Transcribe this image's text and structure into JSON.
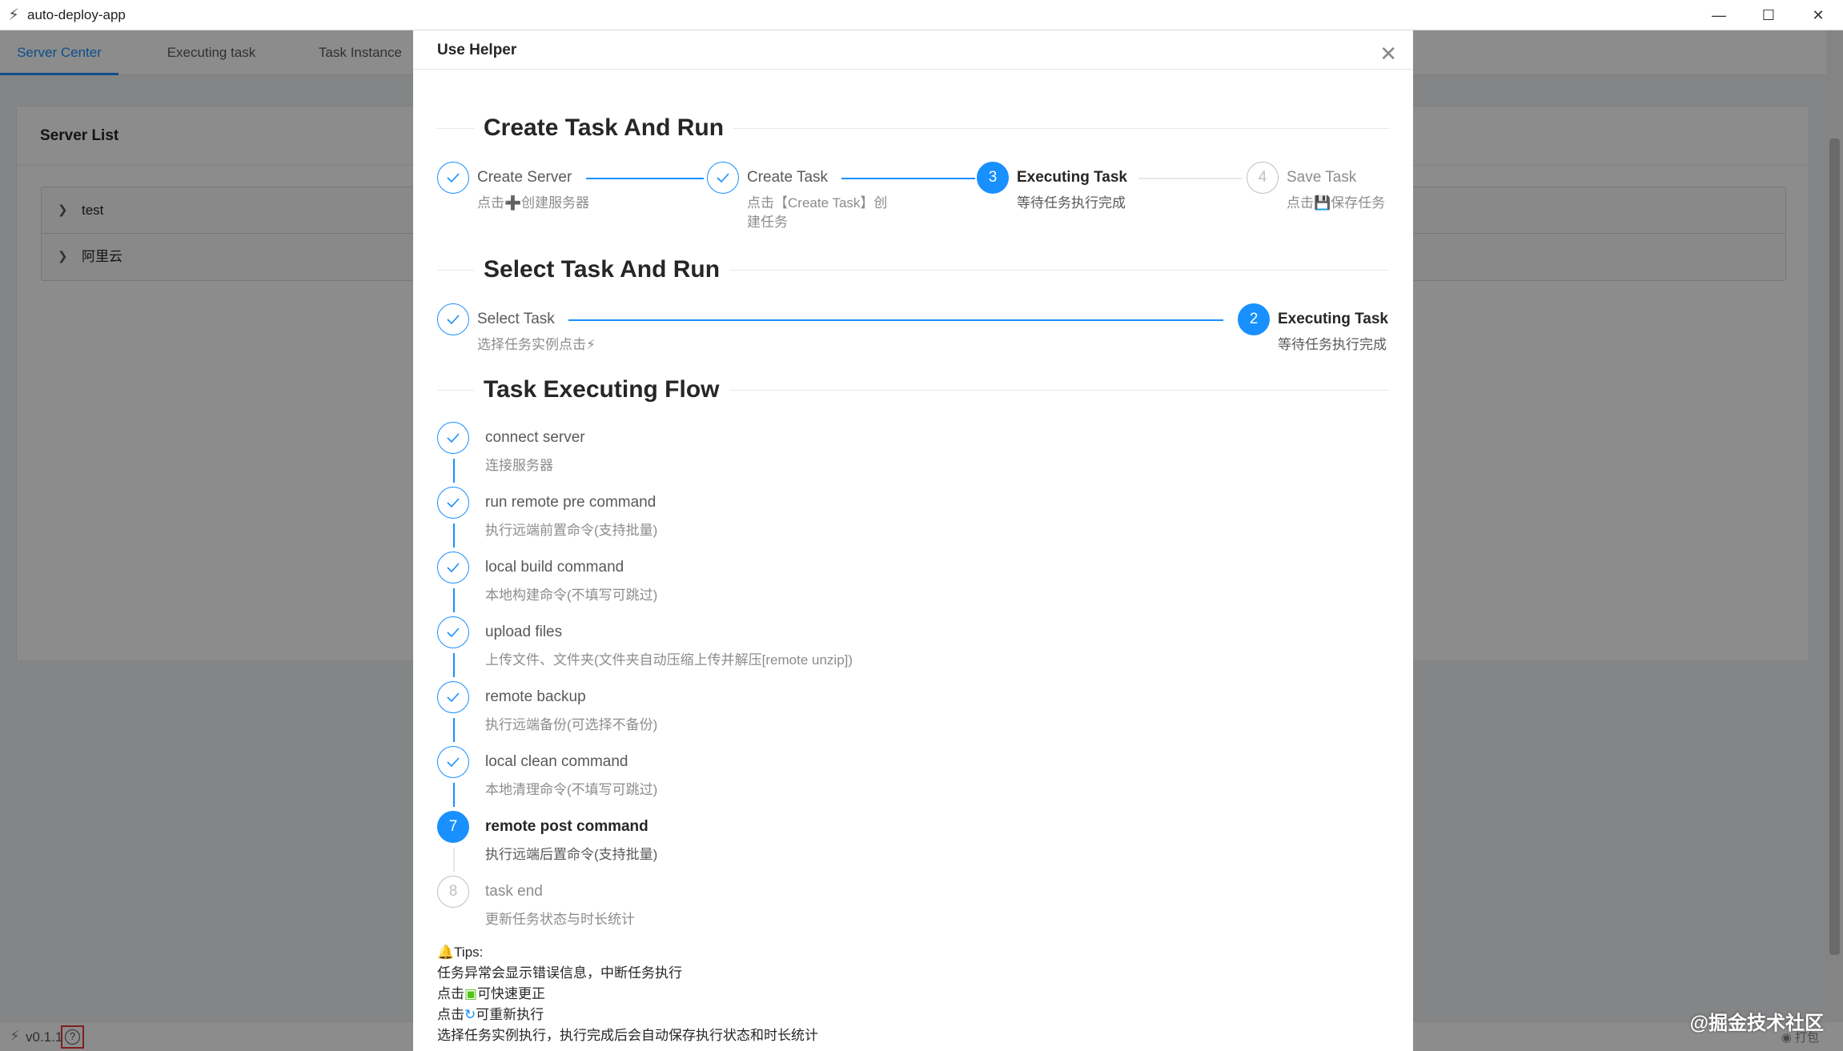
{
  "window": {
    "title": "auto-deploy-app",
    "minimize": "—",
    "maximize": "☐",
    "close": "✕"
  },
  "tabs": [
    {
      "label": "Server Center",
      "active": true
    },
    {
      "label": "Executing task",
      "active": false
    },
    {
      "label": "Task Instance",
      "active": false
    }
  ],
  "server_list": {
    "title": "Server List",
    "items": [
      {
        "label": "test"
      },
      {
        "label": "阿里云"
      }
    ]
  },
  "footer": {
    "version": "v0.1.1",
    "github_label": "打包"
  },
  "watermark": "@掘金技术社区",
  "modal": {
    "title": "Use Helper",
    "close_icon": "✕",
    "sections": {
      "create": {
        "heading": "Create Task And Run",
        "steps": [
          {
            "index": "1",
            "title": "Create Server",
            "desc": "点击➕创建服务器",
            "status": "finish"
          },
          {
            "index": "2",
            "title": "Create Task",
            "desc": "点击【Create Task】创建任务",
            "status": "finish"
          },
          {
            "index": "3",
            "title": "Executing Task",
            "desc": "等待任务执行完成",
            "status": "process"
          },
          {
            "index": "4",
            "title": "Save Task",
            "desc": "点击💾保存任务",
            "status": "wait"
          }
        ]
      },
      "select": {
        "heading": "Select Task And Run",
        "steps": [
          {
            "index": "1",
            "title": "Select Task",
            "desc": "选择任务实例点击⚡",
            "status": "finish"
          },
          {
            "index": "2",
            "title": "Executing Task",
            "desc": "等待任务执行完成",
            "status": "process"
          }
        ]
      },
      "flow": {
        "heading": "Task Executing Flow",
        "steps": [
          {
            "index": "1",
            "title": "connect server",
            "desc": "连接服务器",
            "status": "finish"
          },
          {
            "index": "2",
            "title": "run remote pre command",
            "desc": "执行远端前置命令(支持批量)",
            "status": "finish"
          },
          {
            "index": "3",
            "title": "local build command",
            "desc": "本地构建命令(不填写可跳过)",
            "status": "finish"
          },
          {
            "index": "4",
            "title": "upload files",
            "desc": "上传文件、文件夹(文件夹自动压缩上传并解压[remote unzip])",
            "status": "finish"
          },
          {
            "index": "5",
            "title": "remote backup",
            "desc": "执行远端备份(可选择不备份)",
            "status": "finish"
          },
          {
            "index": "6",
            "title": "local clean command",
            "desc": "本地清理命令(不填写可跳过)",
            "status": "finish"
          },
          {
            "index": "7",
            "title": "remote post command",
            "desc": "执行远端后置命令(支持批量)",
            "status": "process"
          },
          {
            "index": "8",
            "title": "task end",
            "desc": "更新任务状态与时长统计",
            "status": "wait"
          }
        ]
      }
    },
    "tips": {
      "title": "Tips:",
      "lines": [
        "任务异常会显示错误信息，中断任务执行",
        "点击",
        "可快速更正",
        "点击",
        "可重新执行",
        "选择任务实例执行，执行完成后会自动保存执行状态和时长统计"
      ]
    }
  }
}
